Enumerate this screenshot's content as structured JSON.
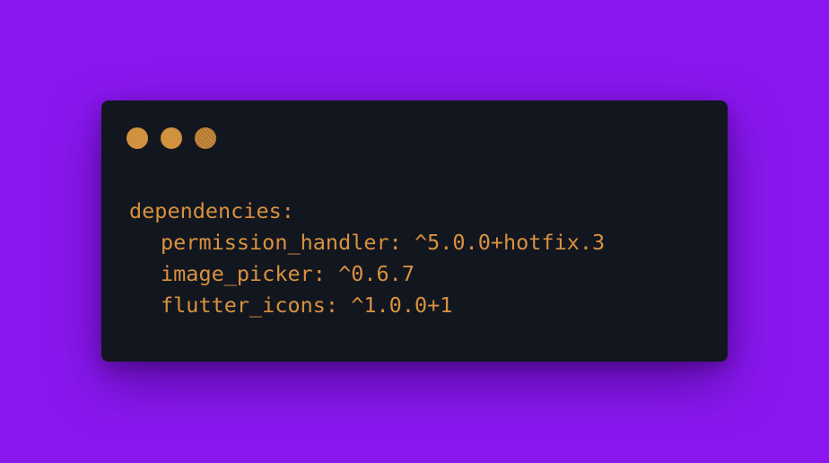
{
  "window": {
    "controls": [
      "close-dot",
      "minimize-dot",
      "maximize-dot"
    ],
    "accent_color": "#d9913f",
    "background_color": "#12161f"
  },
  "page": {
    "background_color": "#8b17f0"
  },
  "code": {
    "lines": [
      {
        "text": "dependencies:",
        "indent": 0
      },
      {
        "text": "permission_handler: ^5.0.0+hotfix.3",
        "indent": 1
      },
      {
        "text": "image_picker: ^0.6.7",
        "indent": 1
      },
      {
        "text": "flutter_icons: ^1.0.0+1",
        "indent": 1
      }
    ]
  }
}
